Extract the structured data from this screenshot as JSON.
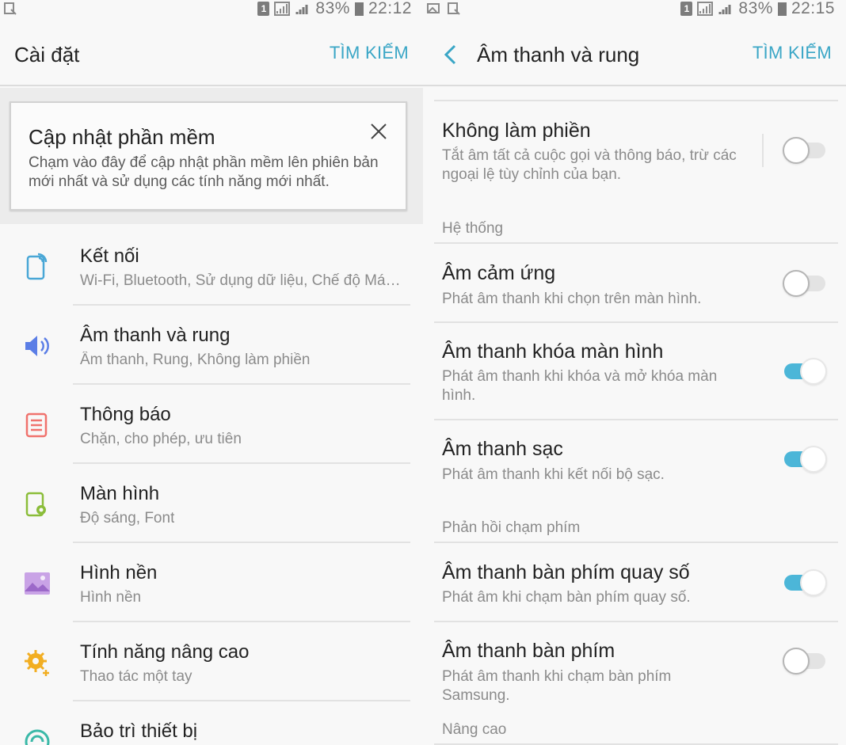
{
  "left": {
    "status": {
      "battery": "83%",
      "time": "22:12",
      "sim": "1"
    },
    "title": "Cài đặt",
    "search": "TÌM KIẾM",
    "update_card": {
      "title": "Cập nhật phần mềm",
      "body": "Chạm vào đây để cập nhật phần mềm lên phiên bản mới nhất và sử dụng các tính năng mới nhất."
    },
    "items": [
      {
        "title": "Kết nối",
        "subtitle": "Wi-Fi, Bluetooth, Sử dụng dữ liệu, Chế độ Má…",
        "icon": "connections-icon",
        "color": "#4aa7d6"
      },
      {
        "title": "Âm thanh và rung",
        "subtitle": "Âm thanh, Rung, Không làm phiền",
        "icon": "speaker-icon",
        "color": "#5b7ee6"
      },
      {
        "title": "Thông báo",
        "subtitle": "Chặn, cho phép, ưu tiên",
        "icon": "notifications-icon",
        "color": "#f0726d"
      },
      {
        "title": "Màn hình",
        "subtitle": "Độ sáng, Font",
        "icon": "display-icon",
        "color": "#8bbd3a"
      },
      {
        "title": "Hình nền",
        "subtitle": "Hình nền",
        "icon": "wallpaper-icon",
        "color": "#b685d9"
      },
      {
        "title": "Tính năng nâng cao",
        "subtitle": "Thao tác một tay",
        "icon": "advanced-features-icon",
        "color": "#f2ae22"
      },
      {
        "title": "Bảo trì thiết bị",
        "subtitle": "",
        "icon": "device-maintenance-icon",
        "color": "#3bb9a8"
      }
    ]
  },
  "right": {
    "status": {
      "battery": "83%",
      "time": "22:15",
      "sim": "1"
    },
    "title": "Âm thanh và rung",
    "search": "TÌM KIẾM",
    "dnd": {
      "title": "Không làm phiền",
      "subtitle": "Tắt âm tất cả cuộc gọi và thông báo, trừ các ngoại lệ tùy chỉnh của bạn.",
      "on": false
    },
    "sections": {
      "system": "Hệ thống",
      "keypad": "Phản hồi chạm phím",
      "advanced": "Nâng cao"
    },
    "rows": {
      "touch": {
        "title": "Âm cảm ứng",
        "subtitle": "Phát âm thanh khi chọn trên màn hình.",
        "on": false
      },
      "lock": {
        "title": "Âm thanh khóa màn hình",
        "subtitle": "Phát âm thanh khi khóa và mở khóa màn hình.",
        "on": true
      },
      "charge": {
        "title": "Âm thanh sạc",
        "subtitle": "Phát âm thanh khi kết nối bộ sạc.",
        "on": true
      },
      "dialpad": {
        "title": "Âm thanh bàn phím quay số",
        "subtitle": "Phát âm khi chạm bàn phím quay số.",
        "on": true
      },
      "keyboard": {
        "title": "Âm thanh bàn phím",
        "subtitle": "Phát âm thanh khi chạm bàn phím Samsung.",
        "on": false
      }
    },
    "accent": "#4cb6d8"
  }
}
